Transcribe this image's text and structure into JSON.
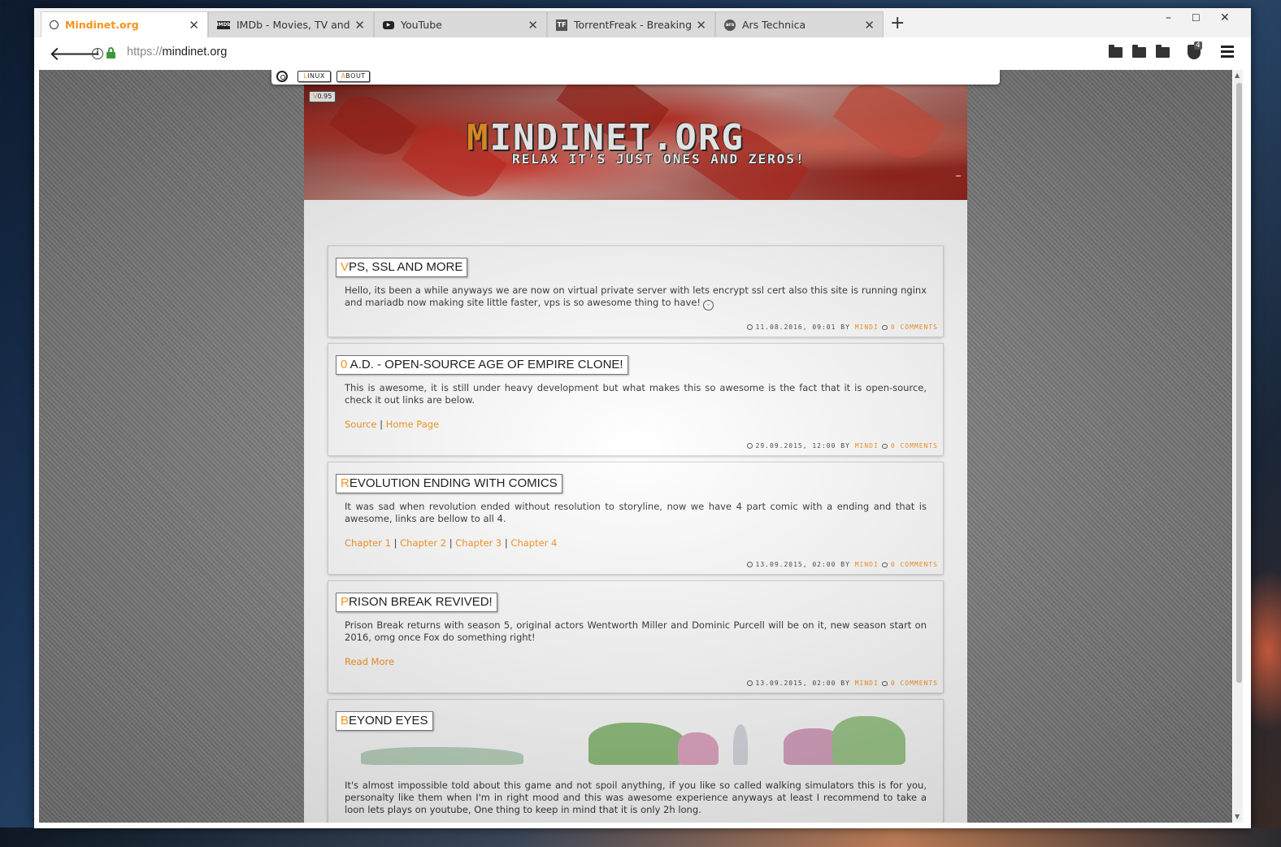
{
  "browser": {
    "tabs": [
      {
        "title": "Mindinet.org",
        "active": true,
        "favicon": "mindinet-icon"
      },
      {
        "title": "IMDb - Movies, TV and Cel...",
        "active": false,
        "favicon": "imdb-icon"
      },
      {
        "title": "YouTube",
        "active": false,
        "favicon": "youtube-icon"
      },
      {
        "title": "TorrentFreak - Breaking Fil...",
        "active": false,
        "favicon": "torrentfreak-icon"
      },
      {
        "title": "Ars Technica",
        "active": false,
        "favicon": "ars-icon"
      }
    ],
    "new_tab": "+",
    "window_controls": {
      "minimize": "–",
      "maximize": "☐",
      "close": "✕"
    },
    "url_scheme": "https://",
    "url_host": "mindinet.org",
    "ublock_count": "4"
  },
  "site": {
    "nav": [
      {
        "first": "L",
        "rest": "INUX"
      },
      {
        "first": "A",
        "rest": "BOUT"
      }
    ],
    "version": {
      "first": "V",
      "rest": "0.95"
    },
    "logo": {
      "first": "M",
      "rest": "INDINET.ORG"
    },
    "tagline": "RELAX IT'S JUST ONES AND ZEROS!"
  },
  "posts": [
    {
      "title_first": "V",
      "title_rest": "PS, SSL AND MORE",
      "body": "Hello, its been a while anyways we are now on virtual private server with lets encrypt ssl cert also this site is running nginx and mariadb now making site little faster, vps is so awesome thing to have!",
      "links": [],
      "date": "11.08.2016, 09:01",
      "by": "BY",
      "author": "MINDI",
      "comments": "0 COMMENTS"
    },
    {
      "title_first": "0",
      "title_rest": " A.D. - OPEN-SOURCE AGE OF EMPIRE CLONE!",
      "body": "This is awesome, it is still under heavy development but what makes this so awesome is the fact that it is open-source, check it out links are below.",
      "links": [
        "Source",
        "Home Page"
      ],
      "date": "29.09.2015, 12:00",
      "by": "BY",
      "author": "MINDI",
      "comments": "0 COMMENTS"
    },
    {
      "title_first": "R",
      "title_rest": "EVOLUTION ENDING WITH COMICS",
      "body": "It was sad when revolution ended without resolution to storyline, now we have 4 part comic with a ending and that is awesome, links are bellow to all 4.",
      "links": [
        "Chapter 1",
        "Chapter 2",
        "Chapter 3",
        "Chapter 4"
      ],
      "date": "13.09.2015, 02:00",
      "by": "BY",
      "author": "MINDI",
      "comments": "0 COMMENTS"
    },
    {
      "title_first": "P",
      "title_rest": "RISON BREAK REVIVED!",
      "body": "Prison Break returns with season 5, original actors Wentworth Miller and Dominic Purcell will be on it, new season start on 2016, omg once Fox do something right!",
      "links": [
        "Read More"
      ],
      "date": "13.09.2015, 02:00",
      "by": "BY",
      "author": "MINDI",
      "comments": "0 COMMENTS"
    },
    {
      "title_first": "B",
      "title_rest": "EYOND EYES",
      "body": "It's almost impossible told about this game and not spoil anything, if you like so called walking simulators this is for you, personalty like them when I'm in right mood and this was awesome experience anyways at least I recommend to take a loon lets plays on youtube, One thing to keep in mind that it is only 2h long.",
      "links": []
    }
  ],
  "separator": "|",
  "colors": {
    "accent": "#f7931e",
    "secure": "#3a9a3a"
  }
}
